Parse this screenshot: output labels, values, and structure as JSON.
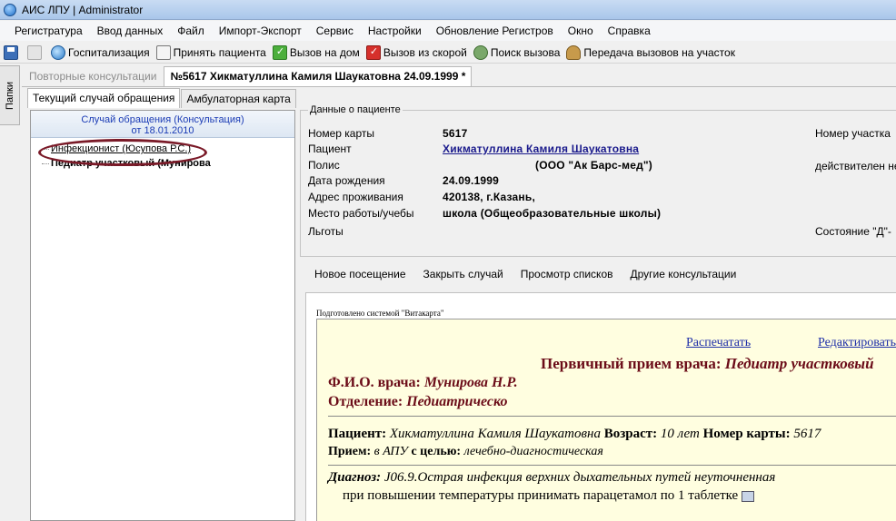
{
  "window": {
    "title": "АИС ЛПУ | Administrator"
  },
  "menu": [
    "Регистратура",
    "Ввод данных",
    "Файл",
    "Импорт-Экспорт",
    "Сервис",
    "Настройки",
    "Обновление Регистров",
    "Окно",
    "Справка"
  ],
  "toolbar": {
    "items": [
      {
        "label": "Госпитализация",
        "icon": "hospitalization-icon"
      },
      {
        "label": "Принять пациента",
        "icon": "accept-patient-icon"
      },
      {
        "label": "Вызов на дом",
        "icon": "home-call-icon"
      },
      {
        "label": "Вызов из скорой",
        "icon": "ambulance-call-icon"
      },
      {
        "label": "Поиск вызова",
        "icon": "search-call-icon"
      },
      {
        "label": "Передача вызовов на участок",
        "icon": "transfer-calls-icon"
      }
    ]
  },
  "side_tab": {
    "label": "Папки"
  },
  "doc_tabs": {
    "inactive": "Повторные консультации",
    "active": "№5617 Хикматуллина Камиля Шаукатовна 24.09.1999 *"
  },
  "sub_tabs": [
    "Текущий случай обращения",
    "Амбулаторная карта"
  ],
  "case": {
    "title": "Случай обращения (Консультация)",
    "date": "от 18.01.2010",
    "items": [
      "Инфекционист (Юсупова Р.С.)",
      "Педиатр участковый (Мунирова"
    ]
  },
  "patient": {
    "legend": "Данные о пациенте",
    "fields": [
      {
        "label": "Номер карты",
        "value": "5617"
      },
      {
        "label": "Пациент",
        "value": "Хикматуллина Камиля Шаукатовна"
      },
      {
        "label": "Полис",
        "value": "(ООО \"Ак Барс-мед\")"
      },
      {
        "label": "Дата рождения",
        "value": "24.09.1999"
      },
      {
        "label": "Адрес проживания",
        "value": "420138, г.Казань,"
      },
      {
        "label": "Место работы/учебы",
        "value": "школа (Общеобразовательные школы)"
      },
      {
        "label": "Льготы",
        "value": ""
      }
    ],
    "right": [
      "Номер участка",
      "действителен не",
      "Состояние \"Д\"-"
    ]
  },
  "actions": [
    "Новое посещение",
    "Закрыть случай",
    "Просмотр списков",
    "Другие консультации"
  ],
  "document": {
    "prepared_by": "Подготовлено системой \"Витакарта\"",
    "print_link": "Распечатать",
    "edit_link": "Редактировать",
    "heading_prefix": "Первичный прием врача:",
    "heading_value": "Педиатр участковый",
    "doctor_label": "Ф.И.О. врача:",
    "doctor_value": "Мунирова Н.Р.",
    "dept_label": "Отделение:",
    "dept_value": "Педиатрическо",
    "patient_label": "Пациент:",
    "patient_value": "Хикматуллина Камиля Шаукатовна",
    "age_label": "Возраст:",
    "age_value": "10 лет",
    "card_label": "Номер карты:",
    "card_value": "5617",
    "reception_label": "Прием:",
    "reception_value": "в АПУ",
    "purpose_label": "с целью:",
    "purpose_value": "лечебно-диагностическая",
    "diagnosis_label": "Диагноз:",
    "diagnosis_value": "J06.9.Острая инфекция верхних дыхательных путей неуточненная",
    "note": "при повышении температуры принимать парацетамол по 1 таблетке"
  }
}
